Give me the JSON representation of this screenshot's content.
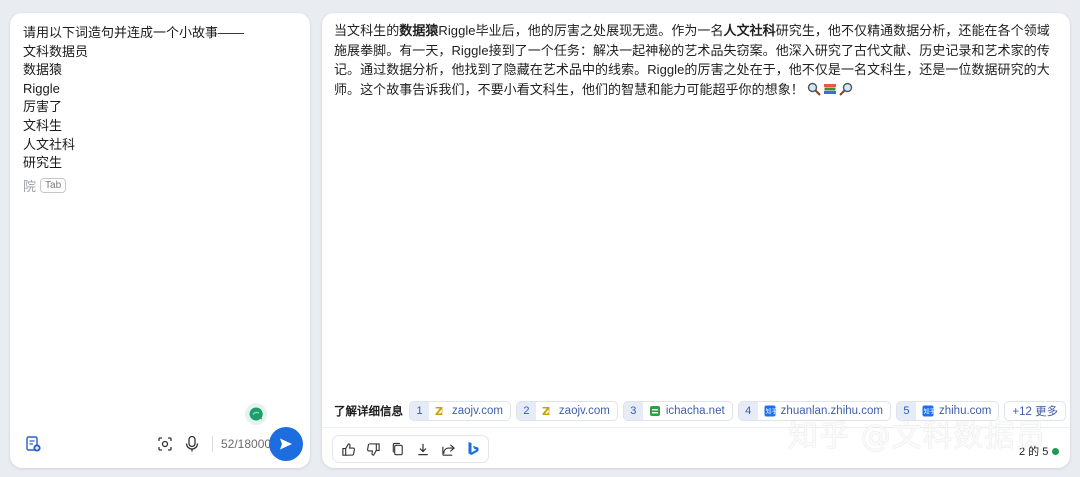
{
  "input": {
    "prompt_lines": [
      "请用以下词造句并连成一个小故事——",
      "文科数据员",
      "数据猿",
      "Riggle",
      "厉害了",
      "文科生",
      "人文社科",
      "研究生"
    ],
    "suggestion": "院",
    "tab_hint": "Tab",
    "char_count": "52/18000"
  },
  "answer": {
    "segments": [
      {
        "text": "当文科生的",
        "bold": false
      },
      {
        "text": "数据猿",
        "bold": true
      },
      {
        "text": "Riggle毕业后，他的厉害之处展现无遗。作为一名",
        "bold": false
      },
      {
        "text": "人文社科",
        "bold": true
      },
      {
        "text": "研究生，他不仅精通数据分析，还能在各个领域施展拳脚。有一天，Riggle接到了一个任务：解决一起神秘的艺术品失窃案。他深入研究了古代文献、历史记录和艺术家的传记。通过数据分析，他找到了隐藏在艺术品中的线索。Riggle的厉害之处在于，他不仅是一名文科生，还是一位数据研究的大师。这个故事告诉我们，不要小看文科生，他们的智慧和能力可能超乎你的想象！",
        "bold": false
      }
    ],
    "emojis": [
      "magnifier-icon",
      "books-icon",
      "magnifier-right-icon"
    ]
  },
  "sources": {
    "label": "了解详细信息",
    "items": [
      {
        "num": "1",
        "site": "zaojv.com",
        "icon": "zaojv-icon",
        "color": "#c7a200"
      },
      {
        "num": "2",
        "site": "zaojv.com",
        "icon": "zaojv-icon",
        "color": "#c7a200"
      },
      {
        "num": "3",
        "site": "ichacha.net",
        "icon": "ichacha-icon",
        "color": "#2ea043"
      },
      {
        "num": "4",
        "site": "zhuanlan.zhihu.com",
        "icon": "zhihu-icon",
        "color": "#1772f6"
      },
      {
        "num": "5",
        "site": "zhihu.com",
        "icon": "zhihu-icon",
        "color": "#1772f6"
      }
    ],
    "more": "+12 更多"
  },
  "footer": {
    "pager": "2 的 5",
    "watermark": "知乎 @文科数据员"
  },
  "colors": {
    "accent": "#1d6dde",
    "page_bg": "#e9edf2",
    "link": "#3f5ea8",
    "status_dot": "#1a9a55"
  }
}
